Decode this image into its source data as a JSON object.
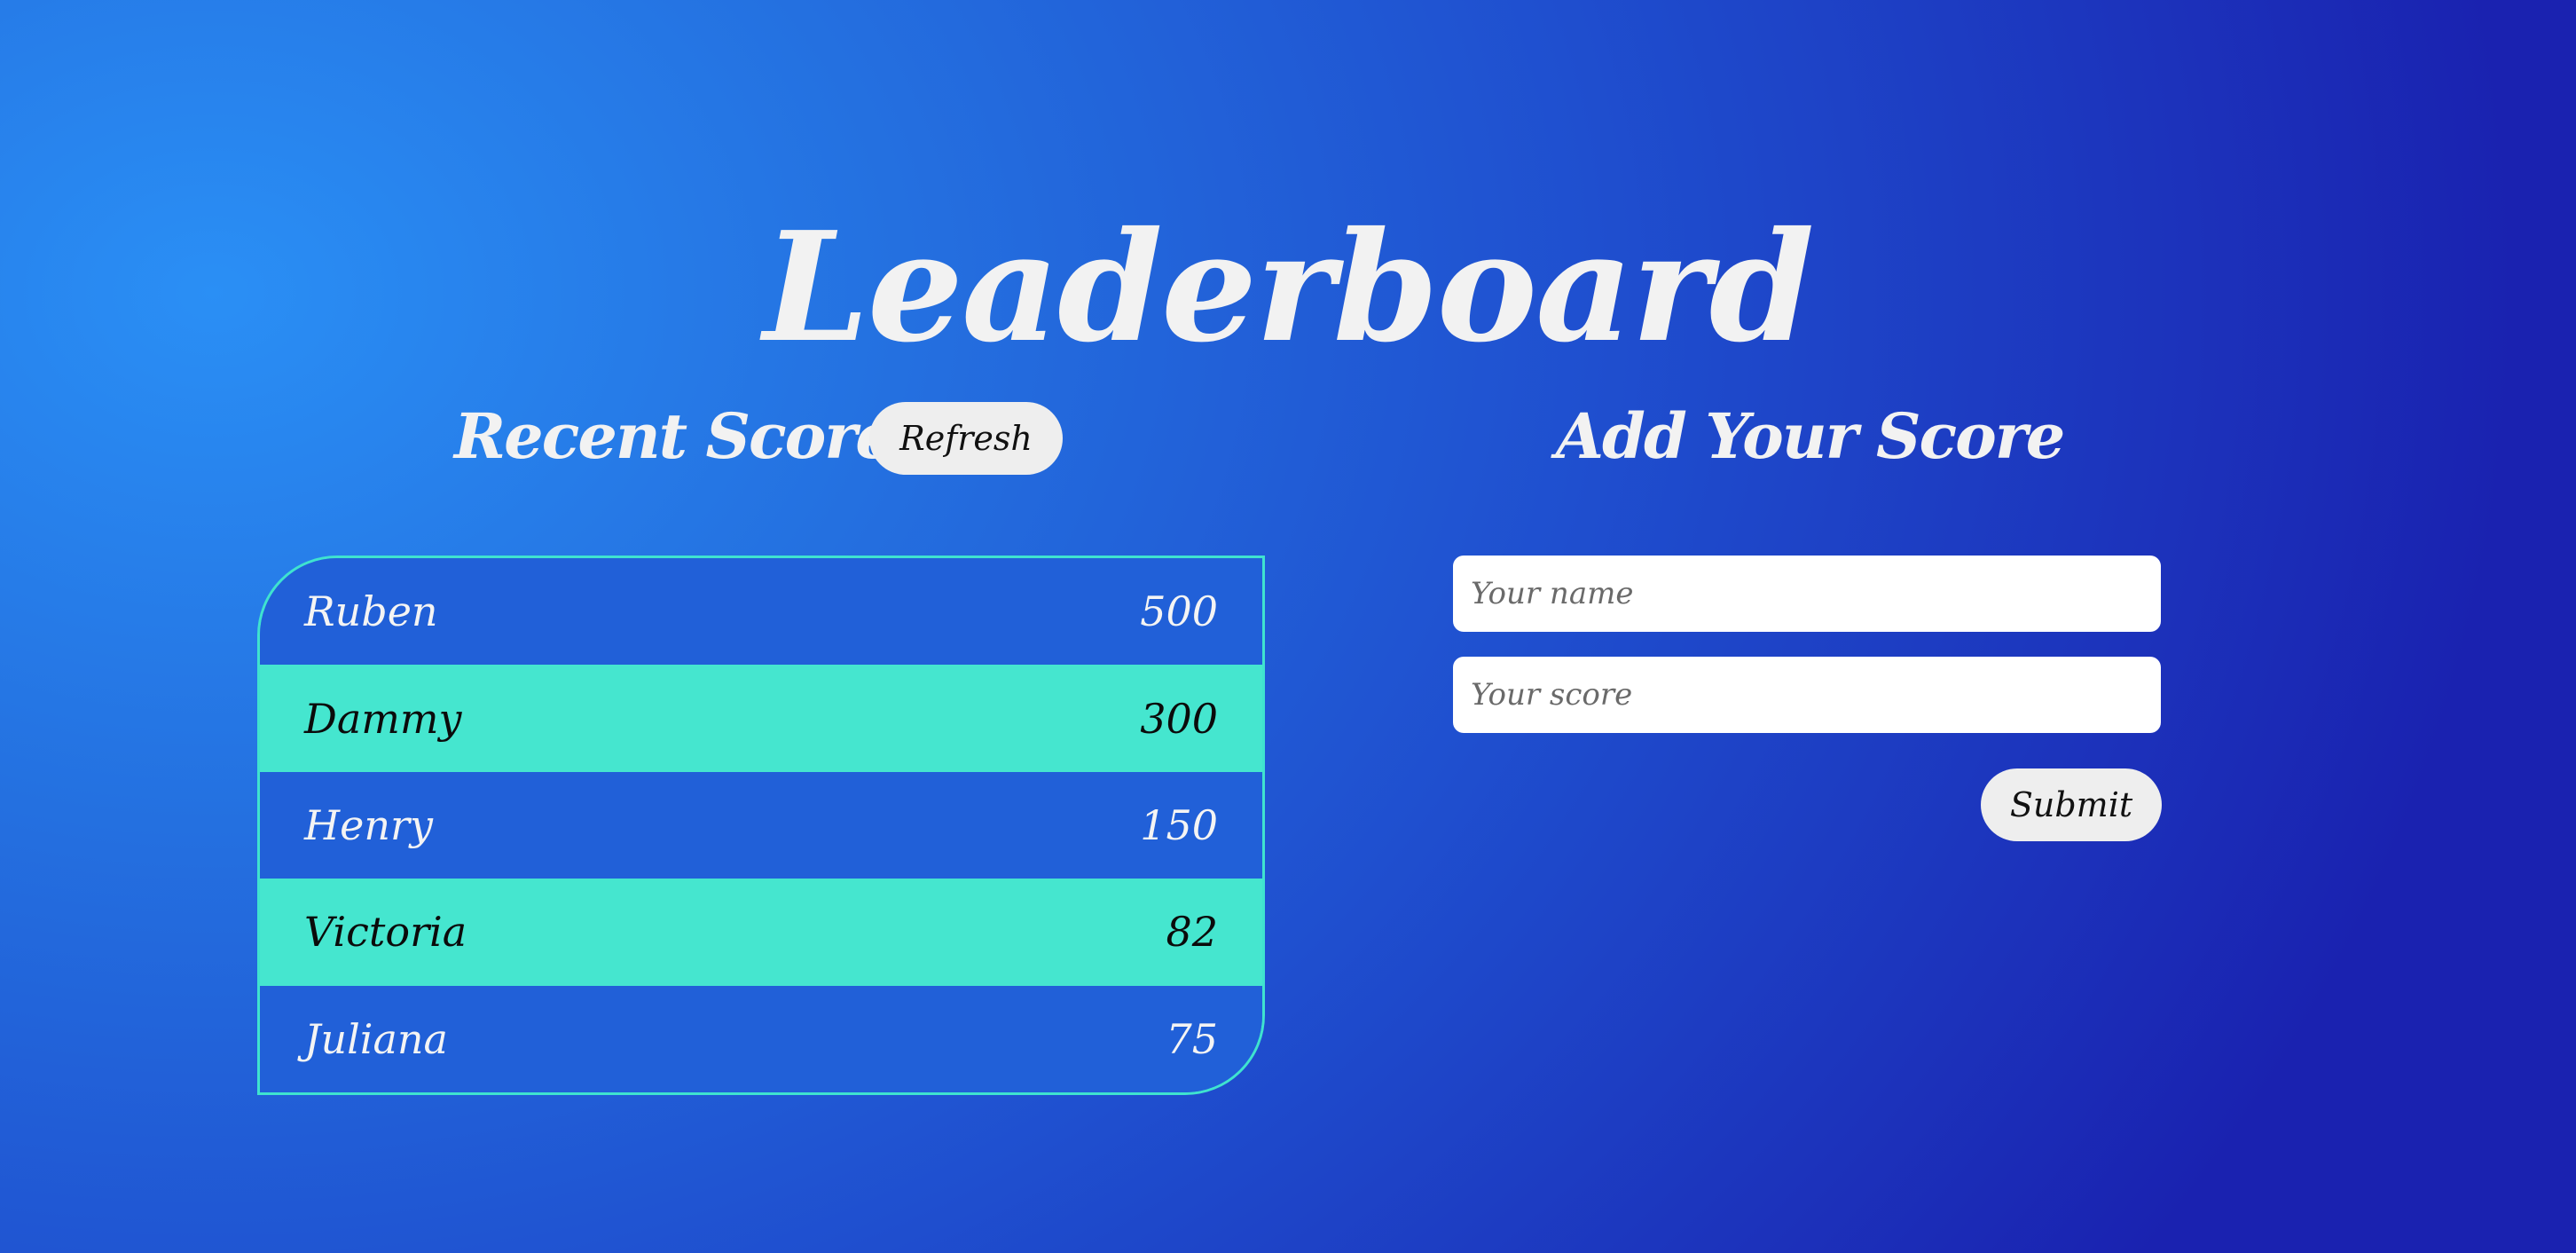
{
  "page": {
    "title": "Leaderboard"
  },
  "recent": {
    "heading": "Recent Scores",
    "refresh_label": "Refresh",
    "scores": [
      {
        "name": "Ruben",
        "score": "500"
      },
      {
        "name": "Dammy",
        "score": "300"
      },
      {
        "name": "Henry",
        "score": "150"
      },
      {
        "name": "Victoria",
        "score": "82"
      },
      {
        "name": "Juliana",
        "score": "75"
      }
    ]
  },
  "add": {
    "heading": "Add Your Score",
    "name_placeholder": "Your name",
    "score_placeholder": "Your score",
    "submit_label": "Submit"
  },
  "colors": {
    "background_light": "#2a8ff5",
    "background_dark": "#1a22b0",
    "row_blue": "#2160d8",
    "row_teal": "#45e6cf",
    "table_border": "#3fe3cf",
    "button_bg": "#eeeeee"
  }
}
